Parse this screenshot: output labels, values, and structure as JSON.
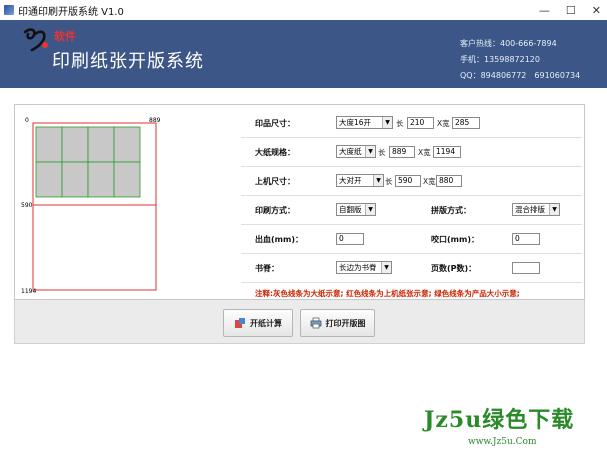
{
  "window": {
    "title": "印通印刷开版系统 V1.0",
    "minimize": "—",
    "maximize": "☐",
    "close": "✕"
  },
  "header": {
    "soft_label": "软件",
    "app_name": "印刷纸张开版系统",
    "hotline": "客户热线：400-666-7894",
    "phone": "手机：13598872120",
    "qq": "QQ：894806772　691060734"
  },
  "preview": {
    "origin_label": "0",
    "width_label": "889",
    "mid_label": "590",
    "height_label": "1194"
  },
  "form": {
    "print_size": {
      "label": "印品尺寸：",
      "select": "大度16开",
      "len_prefix": "长",
      "len": "210",
      "wid_prefix": "X宽",
      "wid": "285"
    },
    "paper_spec": {
      "label": "大纸规格：",
      "select": "大度纸",
      "len_prefix": "长",
      "len": "889",
      "wid_prefix": "X宽",
      "wid": "1194"
    },
    "machine_size": {
      "label": "上机尺寸：",
      "select": "大对开",
      "len_prefix": "长",
      "len": "590",
      "wid_prefix": "X宽",
      "wid": "880"
    },
    "print_mode": {
      "label": "印刷方式：",
      "select": "自翻版"
    },
    "layout_mode": {
      "label": "拼版方式：",
      "select": "混合排版"
    },
    "bleed": {
      "label": "出血(mm)：",
      "value": "0"
    },
    "gripper": {
      "label": "咬口(mm)：",
      "value": "0"
    },
    "spine": {
      "label": "书脊：",
      "select": "长边为书脊"
    },
    "pages": {
      "label": "页数(P数)：",
      "value": ""
    },
    "note": "注释:灰色线条为大纸示意; 红色线条为上机纸张示意; 绿色线条为产品大小示意;"
  },
  "buttons": {
    "calc": "开纸计算",
    "print": "打印开版图"
  },
  "watermark": {
    "big": "Jz5u绿色下载",
    "small": "www.Jz5u.Com"
  },
  "colors": {
    "banner": "#3c5688",
    "machine_line": "#e03030",
    "product_line": "#2a9a2a",
    "product_fill": "#c8c8c8",
    "note": "#cc2200"
  }
}
